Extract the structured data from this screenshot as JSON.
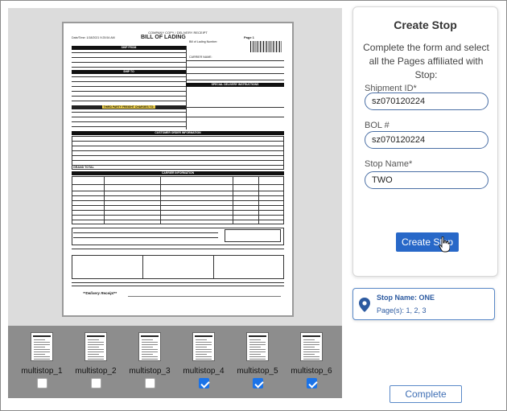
{
  "document": {
    "header": "COMPANY COPY / DELIVERY RECEIPT",
    "title": "BILL OF LADING",
    "page": "Page 1",
    "date_time": "Date/Time: 1/18/2021 9:25:54 AM",
    "bol_number": "Bill of Lading Number:",
    "sections": {
      "ship_from": "SHIP FROM",
      "ship_to": "SHIP TO",
      "third_party": "THIRD PARTY FREIGHT CHARGES TO:",
      "carrier_name": "CARRIER NAME:",
      "special_delivery": "SPECIAL DELIVERY INSTRUCTIONS",
      "customer_order": "CUSTOMER ORDER INFORMATION",
      "carrier_info": "CARRIER INFORMATION",
      "grand_total": "GRAND TOTAL",
      "delivery_receipt": "**Delivery Receipt**"
    }
  },
  "thumbnails": [
    {
      "label": "multistop_1",
      "checked": false
    },
    {
      "label": "multistop_2",
      "checked": false
    },
    {
      "label": "multistop_3",
      "checked": false
    },
    {
      "label": "multistop_4",
      "checked": true
    },
    {
      "label": "multistop_5",
      "checked": true
    },
    {
      "label": "multistop_6",
      "checked": true
    }
  ],
  "panel": {
    "title": "Create Stop",
    "description": "Complete the form and select all the Pages affiliated with Stop:",
    "shipment_id_label": "Shipment ID*",
    "shipment_id_value": "sz070120224",
    "bol_label": "BOL #",
    "bol_value": "sz070120224",
    "stop_name_label": "Stop Name*",
    "stop_name_value": "TWO",
    "create_button": "Create Stop"
  },
  "stop_card": {
    "name": "Stop Name: ONE",
    "pages": "Page(s): 1, 2, 3",
    "icon": "location-pin-icon"
  },
  "complete_button": "Complete",
  "colors": {
    "accent": "#2868c8",
    "checkbox_checked": "#1a73e8",
    "strip_bg": "#8d8d8d",
    "viewer_bg": "#dcdcdc"
  }
}
